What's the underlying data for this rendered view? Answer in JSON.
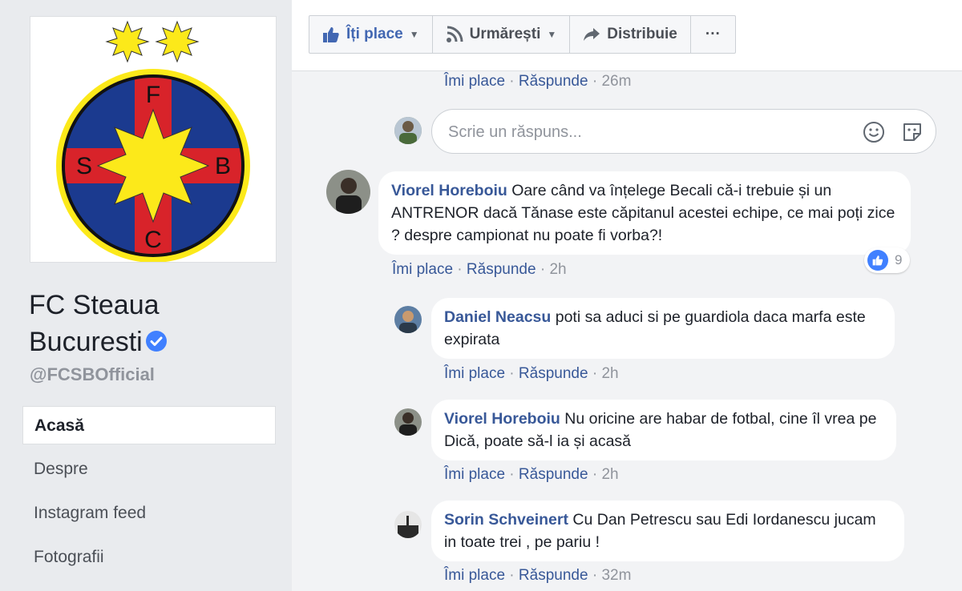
{
  "page": {
    "name": "FC Steaua Bucuresti",
    "handle": "@FCSBOfficial",
    "logo_letters": [
      "F",
      "S",
      "B",
      "C"
    ]
  },
  "nav": [
    {
      "label": "Acasă",
      "active": true
    },
    {
      "label": "Despre",
      "active": false
    },
    {
      "label": "Instagram feed",
      "active": false
    },
    {
      "label": "Fotografii",
      "active": false
    }
  ],
  "actions": {
    "like": "Îți place",
    "follow": "Urmărești",
    "share": "Distribuie",
    "more": "···"
  },
  "reply_placeholder": "Scrie un răspuns...",
  "labels": {
    "like": "Îmi place",
    "reply": "Răspunde",
    "sep": " · "
  },
  "comments": [
    {
      "author": "",
      "text": "",
      "time": "26m"
    },
    {
      "author": "Viorel Horeboiu",
      "text": "Oare când va înțelege Becali că-i trebuie și un ANTRENOR dacă Tănase este căpitanul acestei echipe, ce mai poți zice ? despre campionat nu poate fi vorba?!",
      "time": "2h",
      "reactions": "9"
    },
    {
      "author": "Daniel Neacsu",
      "text": "poti sa aduci si pe guardiola daca marfa este expirata",
      "time": "2h"
    },
    {
      "author": "Viorel Horeboiu",
      "text": "Nu oricine are habar de fotbal, cine îl vrea pe Dică, poate să-l ia și acasă",
      "time": "2h"
    },
    {
      "author": "Sorin Schveinert",
      "text": "Cu Dan Petrescu sau Edi Iordanescu jucam in toate trei , pe pariu !",
      "time": "32m"
    }
  ],
  "colors": {
    "brand_blue": "#385898",
    "background": "#e9ebee",
    "like_blue": "#4080ff",
    "logo_red": "#d8232a",
    "logo_blue": "#1b3a8f",
    "logo_yellow": "#fce91a"
  },
  "icons": [
    "star-icon",
    "verified-badge-icon",
    "thumbs-up-icon",
    "rss-icon",
    "share-arrow-icon",
    "more-icon",
    "emoji-icon",
    "sticker-icon"
  ]
}
